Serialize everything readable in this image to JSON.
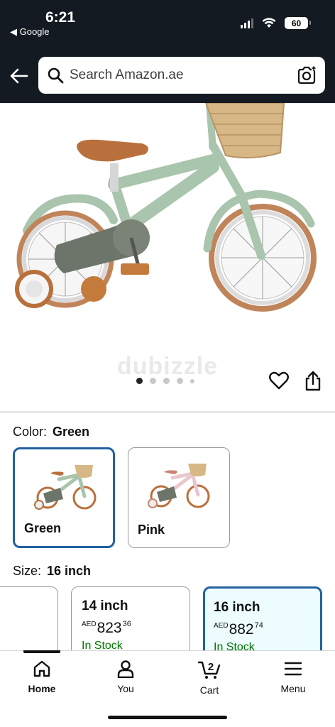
{
  "status_bar": {
    "time": "6:21",
    "back_app": "◀ Google",
    "battery": "60"
  },
  "search": {
    "placeholder": "Search Amazon.ae"
  },
  "product_gallery": {
    "watermark": "dubizzle",
    "image_count": 5,
    "active_index": 0
  },
  "color": {
    "label": "Color:",
    "selected": "Green",
    "options": [
      {
        "name": "Green"
      },
      {
        "name": "Pink"
      }
    ]
  },
  "size": {
    "label": "Size:",
    "selected": "16 inch",
    "options": [
      {
        "size": "",
        "currency": "",
        "whole": "",
        "fraction": "",
        "stock": ""
      },
      {
        "size": "14 inch",
        "currency": "AED",
        "whole": "823",
        "fraction": "36",
        "stock": "In Stock"
      },
      {
        "size": "16 inch",
        "currency": "AED",
        "whole": "882",
        "fraction": "74",
        "stock": "In Stock"
      }
    ]
  },
  "bottom_nav": {
    "items": [
      {
        "label": "Home",
        "icon": "home-icon"
      },
      {
        "label": "You",
        "icon": "person-icon"
      },
      {
        "label": "Cart",
        "icon": "cart-icon",
        "badge": "2"
      },
      {
        "label": "Menu",
        "icon": "menu-icon"
      }
    ]
  },
  "colors": {
    "header_bg": "#131a22",
    "selected_border": "#2162a1",
    "in_stock": "#007600",
    "bike_frame": "#a9c5ad"
  }
}
